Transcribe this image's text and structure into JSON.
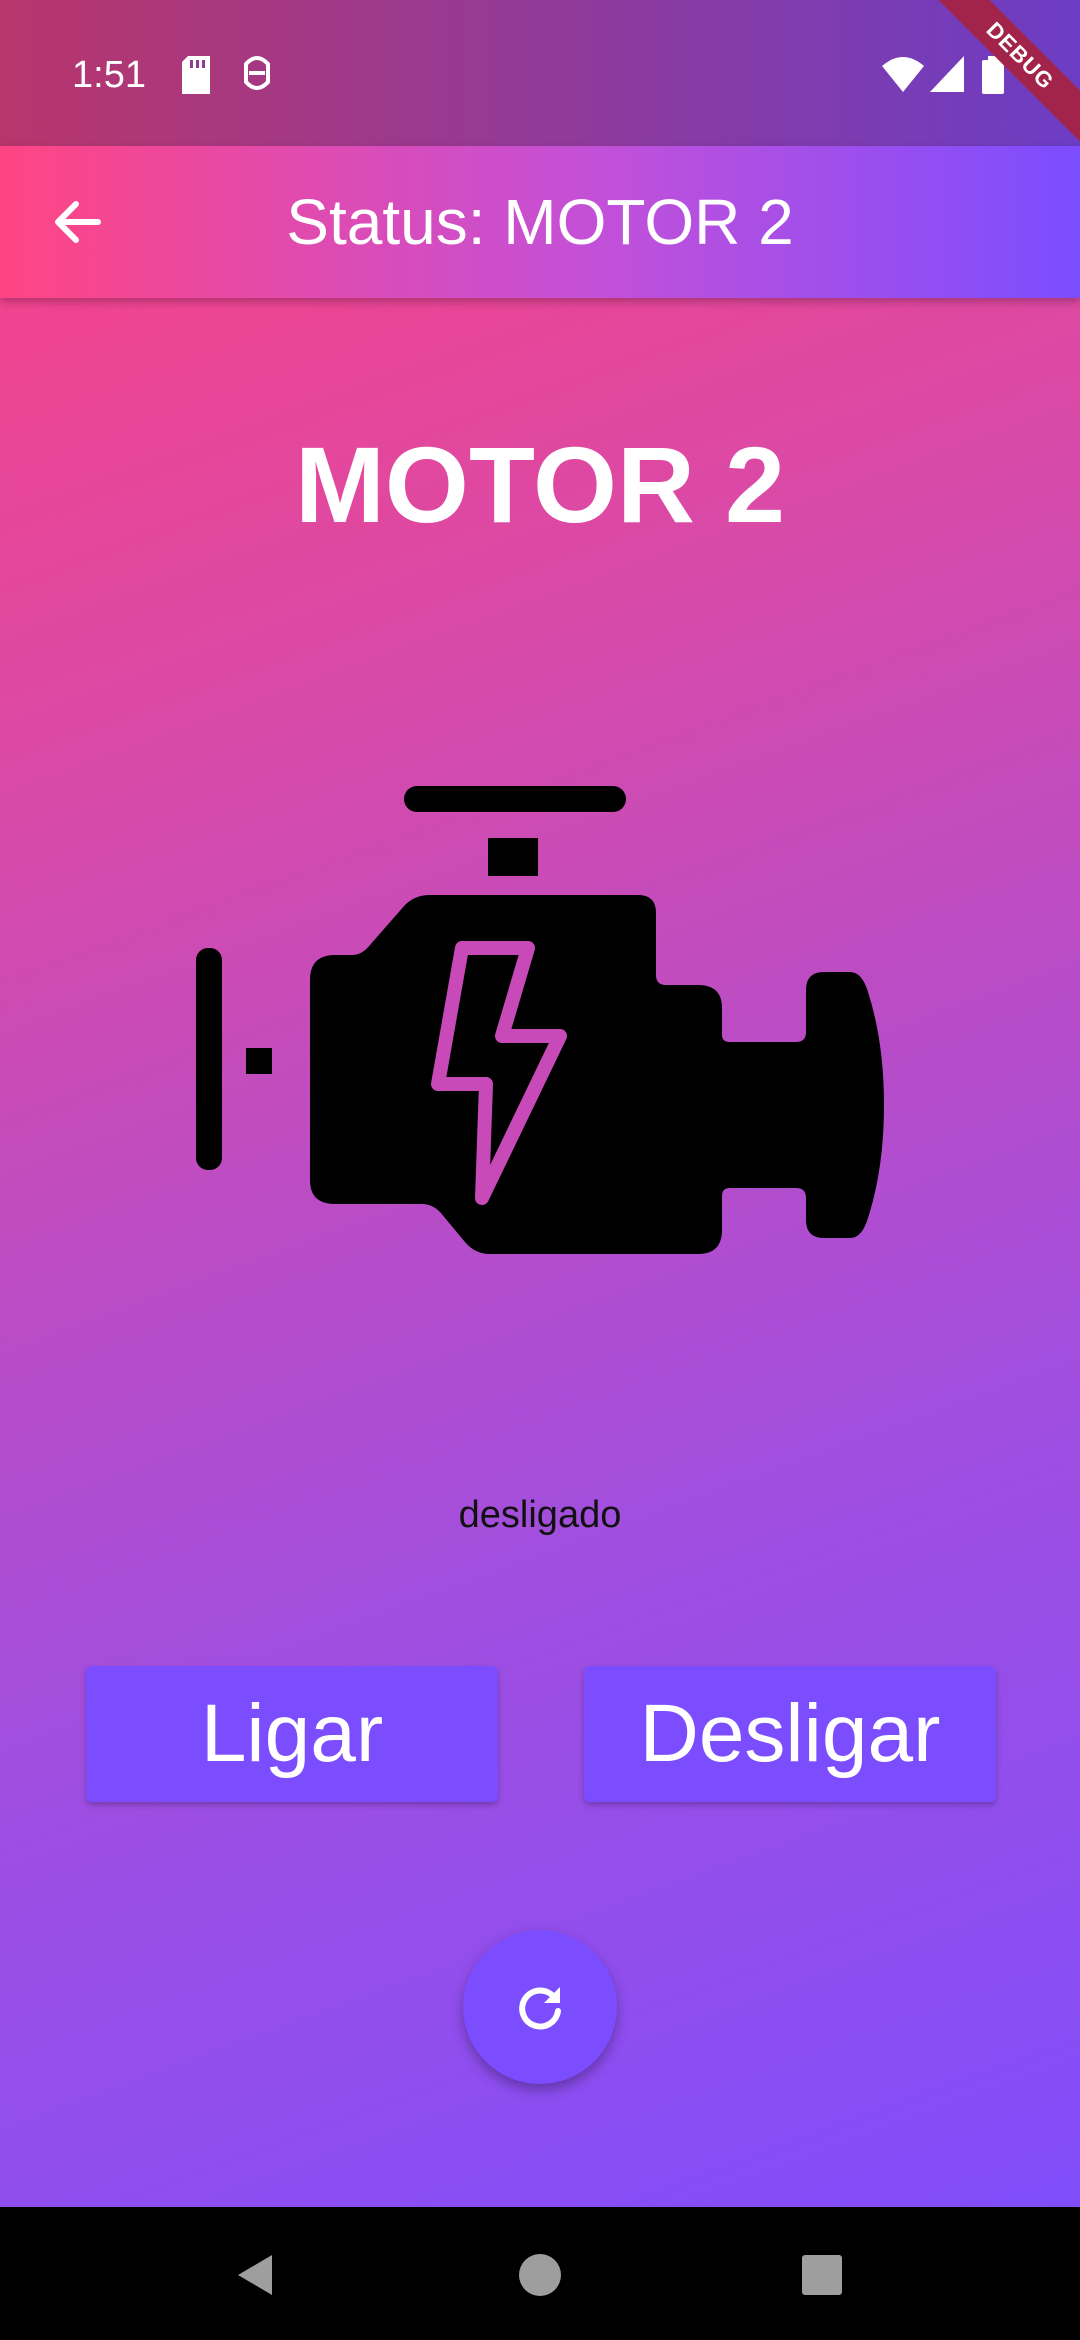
{
  "status_bar": {
    "time": "1:51",
    "icons": [
      "sd-card-icon",
      "accessibility-icon",
      "wifi-icon",
      "signal-icon",
      "battery-icon"
    ],
    "debug_label": "DEBUG"
  },
  "app_bar": {
    "title": "Status: MOTOR 2",
    "back_icon": "arrow-back-icon"
  },
  "main": {
    "motor_name": "MOTOR 2",
    "engine_icon": "engine-lightning-icon",
    "status": "desligado",
    "buttons": {
      "on_label": "Ligar",
      "off_label": "Desligar"
    },
    "refresh_icon": "refresh-icon"
  },
  "nav_bar": {
    "icons": [
      "back-triangle-icon",
      "home-circle-icon",
      "recents-square-icon"
    ]
  },
  "colors": {
    "accent": "#7c4dff",
    "gradient_start": "#ff4081",
    "gradient_end": "#7c4dff",
    "engine_fill": "#000000",
    "text_light": "#ffffff",
    "status_text": "#111111"
  }
}
